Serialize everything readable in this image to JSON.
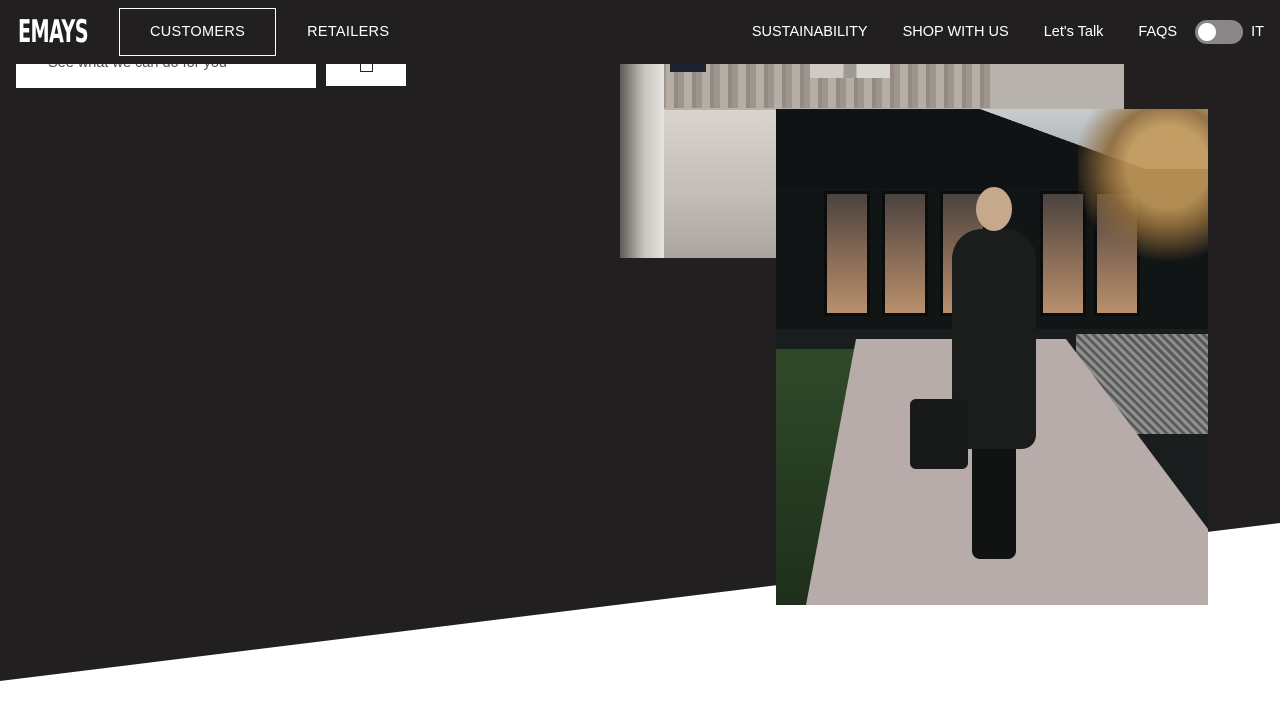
{
  "brand": {
    "logo_text": "EMAYS"
  },
  "nav": {
    "primary": [
      {
        "label": "CUSTOMERS",
        "active": true
      },
      {
        "label": "RETAILERS",
        "active": false
      }
    ],
    "secondary": [
      {
        "label": "SUSTAINABILITY"
      },
      {
        "label": "SHOP WITH US"
      },
      {
        "label": "Let's Talk"
      },
      {
        "label": "FAQS"
      }
    ],
    "language": {
      "label": "IT",
      "toggle_on": false
    }
  },
  "search": {
    "placeholder": "See what we can do for you",
    "button_icon": "submit-icon"
  },
  "colors": {
    "hero_bg": "#221f20",
    "page_bg": "#ffffff",
    "toggle_track": "#8a8788"
  },
  "images": [
    {
      "name": "interior-photo",
      "icon": "photo"
    },
    {
      "name": "woman-walking-photo",
      "icon": "photo"
    }
  ]
}
